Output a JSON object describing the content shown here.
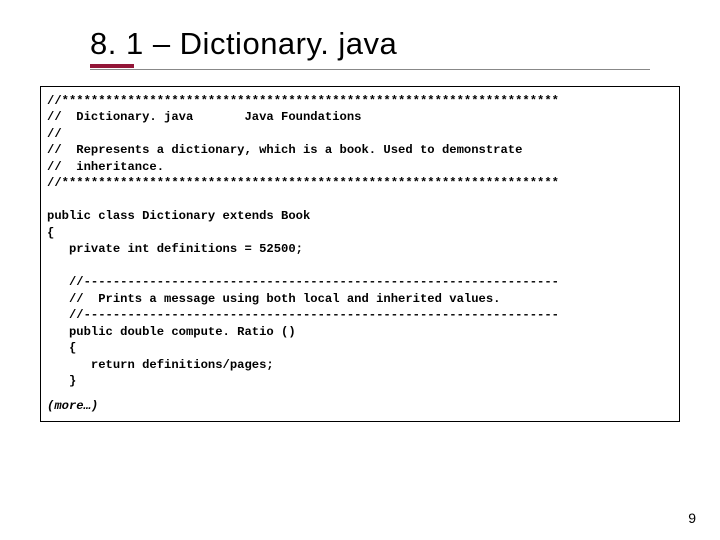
{
  "slide": {
    "title": "8. 1 – Dictionary. java",
    "page_number": "9",
    "more_label": "(more…)"
  },
  "code": {
    "l01": "//********************************************************************",
    "l02": "//  Dictionary. java       Java Foundations",
    "l03": "//",
    "l04": "//  Represents a dictionary, which is a book. Used to demonstrate",
    "l05": "//  inheritance.",
    "l06": "//********************************************************************",
    "l07": "",
    "l08": "public class Dictionary extends Book",
    "l09": "{",
    "l10": "   private int definitions = 52500;",
    "l11": "",
    "l12": "   //-----------------------------------------------------------------",
    "l13": "   //  Prints a message using both local and inherited values.",
    "l14": "   //-----------------------------------------------------------------",
    "l15": "   public double compute. Ratio ()",
    "l16": "   {",
    "l17": "      return definitions/pages;",
    "l18": "   }"
  }
}
